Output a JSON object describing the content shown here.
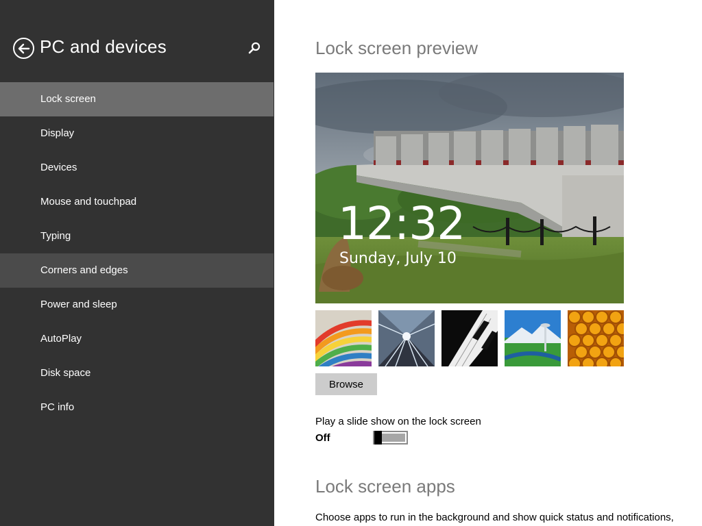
{
  "sidebar": {
    "title": "PC and devices",
    "back_icon": "back-arrow-circle-icon",
    "search_icon": "search-icon",
    "items": [
      {
        "label": "Lock screen",
        "state": "selected"
      },
      {
        "label": "Display",
        "state": ""
      },
      {
        "label": "Devices",
        "state": ""
      },
      {
        "label": "Mouse and touchpad",
        "state": ""
      },
      {
        "label": "Typing",
        "state": ""
      },
      {
        "label": "Corners and edges",
        "state": "hover"
      },
      {
        "label": "Power and sleep",
        "state": ""
      },
      {
        "label": "AutoPlay",
        "state": ""
      },
      {
        "label": "Disk space",
        "state": ""
      },
      {
        "label": "PC info",
        "state": ""
      }
    ]
  },
  "main": {
    "preview_title": "Lock screen preview",
    "preview": {
      "time": "12:32",
      "date": "Sunday, July 10"
    },
    "thumbnails": [
      "colorful-stripes",
      "train-tunnel",
      "piano-keys",
      "seattle-skyline",
      "honeycomb"
    ],
    "browse_label": "Browse",
    "slideshow": {
      "label": "Play a slide show on the lock screen",
      "state": "Off"
    },
    "apps_title": "Lock screen apps",
    "apps_description": "Choose apps to run in the background and show quick status and notifications,"
  },
  "colors": {
    "sidebar_bg": "#323232",
    "selected_bg": "#6d6d6d",
    "hover_bg": "#4b4b4b",
    "title_gray": "#7a7a7a",
    "button_gray": "#cccccc"
  }
}
